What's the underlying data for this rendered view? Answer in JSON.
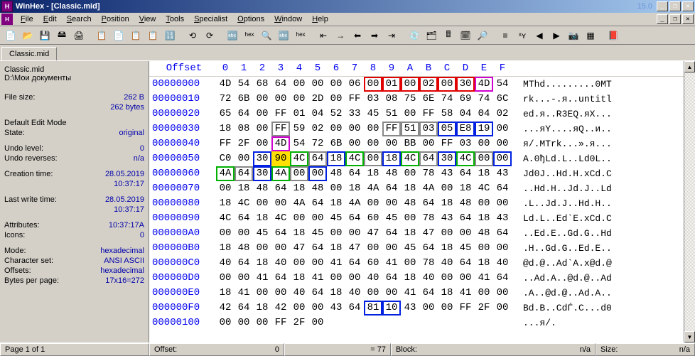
{
  "title": "WinHex - [Classic.mid]",
  "version": "15.0",
  "menu": [
    "File",
    "Edit",
    "Search",
    "Position",
    "View",
    "Tools",
    "Specialist",
    "Options",
    "Window",
    "Help"
  ],
  "menu_accel": [
    0,
    0,
    0,
    0,
    0,
    0,
    0,
    0,
    0,
    0
  ],
  "tab": "Classic.mid",
  "info": {
    "filename": "Classic.mid",
    "filepath": "D:\\Мои документы",
    "filesize_label": "File size:",
    "filesize_val1": "262 B",
    "filesize_val2": "262 bytes",
    "editmode_label": "Default Edit Mode",
    "state_label": "State:",
    "state_val": "original",
    "undolevel_label": "Undo level:",
    "undolevel_val": "0",
    "undorev_label": "Undo reverses:",
    "undorev_val": "n/a",
    "ctime_label": "Creation time:",
    "ctime_val1": "28.05.2019",
    "ctime_val2": "10:37:17",
    "mtime_label": "Last write time:",
    "mtime_val1": "28.05.2019",
    "mtime_val2": "10:37:17",
    "attr_label": "Attributes:",
    "attr_val": "10:37:17A",
    "icons_label": "Icons:",
    "icons_val": "0",
    "mode_label": "Mode:",
    "mode_val": "hexadecimal",
    "charset_label": "Character set:",
    "charset_val": "ANSI ASCII",
    "offsets_label": "Offsets:",
    "offsets_val": "hexadecimal",
    "bpp_label": "Bytes per page:",
    "bpp_val": "17x16=272"
  },
  "hex_header_offset": "Offset",
  "hex_header_cols": [
    "0",
    "1",
    "2",
    "3",
    "4",
    "5",
    "6",
    "7",
    "8",
    "9",
    "A",
    "B",
    "C",
    "D",
    "E",
    "F"
  ],
  "rows": [
    {
      "off": "00000000",
      "bytes": [
        "4D",
        "54",
        "68",
        "64",
        "00",
        "00",
        "00",
        "06",
        "00",
        "01",
        "00",
        "02",
        "00",
        "30",
        "4D",
        "54"
      ],
      "hl": {
        "8": "red",
        "9": "red",
        "10": "red",
        "11": "red",
        "12": "red",
        "13": "red",
        "14": "mag"
      },
      "ascii": "MThd.........0MT"
    },
    {
      "off": "00000010",
      "bytes": [
        "72",
        "6B",
        "00",
        "00",
        "00",
        "2D",
        "00",
        "FF",
        "03",
        "08",
        "75",
        "6E",
        "74",
        "69",
        "74",
        "6C"
      ],
      "hl": {},
      "ascii": "rk...-.я..untitl"
    },
    {
      "off": "00000020",
      "bytes": [
        "65",
        "64",
        "00",
        "FF",
        "01",
        "04",
        "52",
        "33",
        "45",
        "51",
        "00",
        "FF",
        "58",
        "04",
        "04",
        "02"
      ],
      "hl": {},
      "ascii": "ed.я..R3EQ.яX..."
    },
    {
      "off": "00000030",
      "bytes": [
        "18",
        "08",
        "00",
        "FF",
        "59",
        "02",
        "00",
        "00",
        "00",
        "FF",
        "51",
        "03",
        "05",
        "E8",
        "19",
        "00"
      ],
      "hl": {
        "3": "grey",
        "9": "grey",
        "10": "grey",
        "11": "grey",
        "12": "blue",
        "13": "blue",
        "14": "blue"
      },
      "ascii": "...яY....яQ..и.."
    },
    {
      "off": "00000040",
      "bytes": [
        "FF",
        "2F",
        "00",
        "4D",
        "54",
        "72",
        "6B",
        "00",
        "00",
        "00",
        "BB",
        "00",
        "FF",
        "03",
        "00",
        "00"
      ],
      "hl": {
        "3": "mag"
      },
      "ascii": "я/.MTrk...».я..."
    },
    {
      "off": "00000050",
      "bytes": [
        "C0",
        "00",
        "30",
        "90",
        "4C",
        "64",
        "18",
        "4C",
        "00",
        "18",
        "4C",
        "64",
        "30",
        "4C",
        "00",
        "00"
      ],
      "hl": {
        "2": "blue",
        "3": "yellow",
        "4": "green",
        "5": "grey",
        "6": "blue",
        "7": "green",
        "8": "grey",
        "9": "blue",
        "10": "green",
        "11": "grey",
        "12": "blue",
        "13": "green",
        "14": "grey",
        "15": "blue"
      },
      "ascii": "А.0ђLd.L..Ld0L.."
    },
    {
      "off": "00000060",
      "bytes": [
        "4A",
        "64",
        "30",
        "4A",
        "00",
        "00",
        "48",
        "64",
        "18",
        "48",
        "00",
        "78",
        "43",
        "64",
        "18",
        "43"
      ],
      "hl": {
        "0": "green",
        "1": "grey",
        "2": "blue",
        "3": "green",
        "4": "grey",
        "5": "blue"
      },
      "ascii": "Jd0J..Hd.H.xCd.C"
    },
    {
      "off": "00000070",
      "bytes": [
        "00",
        "18",
        "48",
        "64",
        "18",
        "48",
        "00",
        "18",
        "4A",
        "64",
        "18",
        "4A",
        "00",
        "18",
        "4C",
        "64"
      ],
      "hl": {},
      "ascii": "..Hd.H..Jd.J..Ld"
    },
    {
      "off": "00000080",
      "bytes": [
        "18",
        "4C",
        "00",
        "00",
        "4A",
        "64",
        "18",
        "4A",
        "00",
        "00",
        "48",
        "64",
        "18",
        "48",
        "00",
        "00"
      ],
      "hl": {},
      "ascii": ".L..Jd.J..Hd.H.."
    },
    {
      "off": "00000090",
      "bytes": [
        "4C",
        "64",
        "18",
        "4C",
        "00",
        "00",
        "45",
        "64",
        "60",
        "45",
        "00",
        "78",
        "43",
        "64",
        "18",
        "43"
      ],
      "hl": {},
      "ascii": "Ld.L..Ed`E.xCd.C"
    },
    {
      "off": "000000A0",
      "bytes": [
        "00",
        "00",
        "45",
        "64",
        "18",
        "45",
        "00",
        "00",
        "47",
        "64",
        "18",
        "47",
        "00",
        "00",
        "48",
        "64"
      ],
      "hl": {},
      "ascii": "..Ed.E..Gd.G..Hd"
    },
    {
      "off": "000000B0",
      "bytes": [
        "18",
        "48",
        "00",
        "00",
        "47",
        "64",
        "18",
        "47",
        "00",
        "00",
        "45",
        "64",
        "18",
        "45",
        "00",
        "00"
      ],
      "hl": {},
      "ascii": ".H..Gd.G..Ed.E.."
    },
    {
      "off": "000000C0",
      "bytes": [
        "40",
        "64",
        "18",
        "40",
        "00",
        "00",
        "41",
        "64",
        "60",
        "41",
        "00",
        "78",
        "40",
        "64",
        "18",
        "40"
      ],
      "hl": {},
      "ascii": "@d.@..Ad`A.x@d.@"
    },
    {
      "off": "000000D0",
      "bytes": [
        "00",
        "00",
        "41",
        "64",
        "18",
        "41",
        "00",
        "00",
        "40",
        "64",
        "18",
        "40",
        "00",
        "00",
        "41",
        "64"
      ],
      "hl": {},
      "ascii": "..Ad.A..@d.@..Ad"
    },
    {
      "off": "000000E0",
      "bytes": [
        "18",
        "41",
        "00",
        "00",
        "40",
        "64",
        "18",
        "40",
        "00",
        "00",
        "41",
        "64",
        "18",
        "41",
        "00",
        "00"
      ],
      "hl": {},
      "ascii": ".A..@d.@..Ad.A.."
    },
    {
      "off": "000000F0",
      "bytes": [
        "42",
        "64",
        "18",
        "42",
        "00",
        "00",
        "43",
        "64",
        "81",
        "10",
        "43",
        "00",
        "00",
        "FF",
        "2F",
        "00"
      ],
      "hl": {
        "8": "blue",
        "9": "blue"
      },
      "ascii": "Bd.B..CdЃ.C...d0"
    },
    {
      "off": "00000100",
      "bytes": [
        "00",
        "00",
        "00",
        "FF",
        "2F",
        "00",
        "",
        "",
        "",
        "",
        "",
        "",
        "",
        "",
        "",
        ""
      ],
      "hl": {},
      "ascii": "...я/."
    }
  ],
  "status": {
    "page": "Page 1 of 1",
    "offset_label": "Offset:",
    "offset_val": "0",
    "eq77": "= 77",
    "block_label": "Block:",
    "block_val": "n/a",
    "size_label": "Size:",
    "size_val": "n/a"
  },
  "toolbar_icons": [
    "📄",
    "📂",
    "💾",
    "🖴",
    "🖨",
    "│",
    "📋",
    "📄",
    "📋",
    "📋",
    "🔢",
    "│",
    "⟲",
    "⟳",
    "│",
    "🔤",
    "ʰᵉˣ",
    "🔍",
    "🔤",
    "ʰᵉˣ",
    "│",
    "⇤",
    "→",
    "⬅",
    "➡",
    "⇥",
    "│",
    "💿",
    "🗂",
    "🖩",
    "🗓",
    "🔎",
    "│",
    "≡",
    "ˣʏ",
    "◀",
    "▶",
    "📷",
    "▦",
    "│",
    "📕"
  ]
}
